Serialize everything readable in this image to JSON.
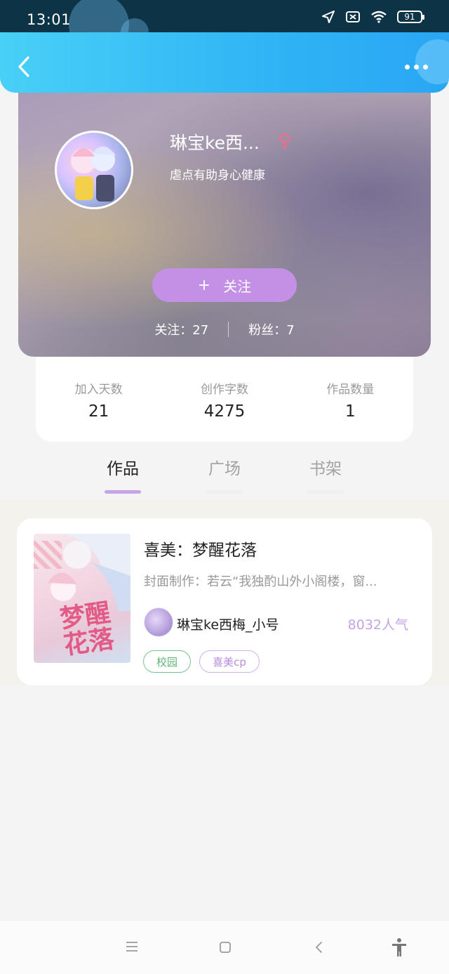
{
  "status_bar": {
    "time": "13:01",
    "battery": "91"
  },
  "header": {
    "back_icon": "chevron-left-icon",
    "more_icon": "more-horizontal-icon"
  },
  "profile": {
    "nickname": "琳宝ke西...",
    "gender_symbol": "♀",
    "signature": "虐点有助身心健康",
    "follow_button": {
      "plus": "+",
      "label": "关注"
    },
    "following": "关注：27",
    "followers": "粉丝：7"
  },
  "stats": [
    {
      "label": "加入天数",
      "value": "21"
    },
    {
      "label": "创作字数",
      "value": "4275"
    },
    {
      "label": "作品数量",
      "value": "1"
    }
  ],
  "tabs": [
    {
      "label": "作品",
      "active": true
    },
    {
      "label": "广场",
      "active": false
    },
    {
      "label": "书架",
      "active": false
    }
  ],
  "work": {
    "cover_title": "梦醒花落",
    "title": "喜美：梦醒花落",
    "description": "封面制作：若云“我独酌山外小阁楼，窗...",
    "author": "琳宝ke西梅_小号",
    "popularity": "8032人气",
    "tags": [
      "校园",
      "喜美cp"
    ]
  },
  "colors": {
    "header_blue": "#30b4f5",
    "accent_purple": "#c390e6",
    "tag_green": "#5fb574"
  }
}
